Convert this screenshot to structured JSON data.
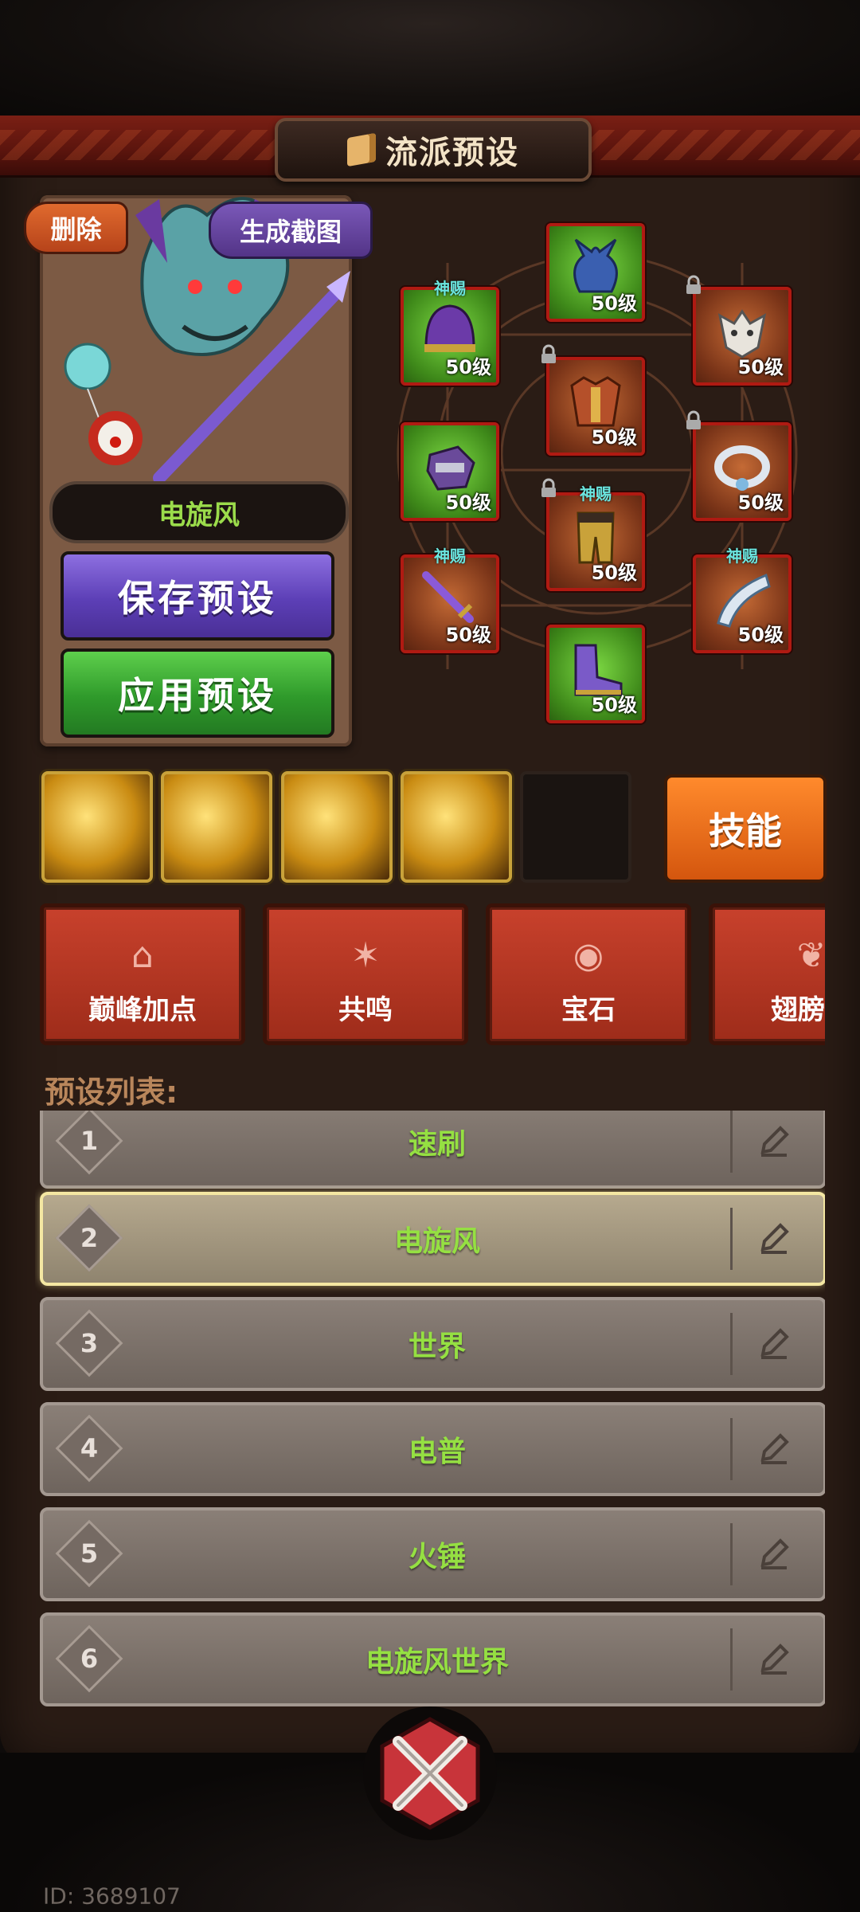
{
  "header": {
    "title": "流派预设"
  },
  "hero": {
    "delete_label": "删除",
    "screenshot_label": "生成截图",
    "build_name": "电旋风",
    "save_label": "保存预设",
    "apply_label": "应用预设"
  },
  "equipment": {
    "slots": [
      {
        "name": "helmet",
        "badge": "神赐",
        "level": "50级",
        "locked": false,
        "rarity": "green"
      },
      {
        "name": "horned-helm",
        "badge": "",
        "level": "50级",
        "locked": false,
        "rarity": "green"
      },
      {
        "name": "beast-mask",
        "badge": "",
        "level": "50级",
        "locked": true,
        "rarity": "orange"
      },
      {
        "name": "chest-armor",
        "badge": "",
        "level": "50级",
        "locked": true,
        "rarity": "orange"
      },
      {
        "name": "gauntlets",
        "badge": "",
        "level": "50级",
        "locked": false,
        "rarity": "green"
      },
      {
        "name": "necklace",
        "badge": "",
        "level": "50级",
        "locked": true,
        "rarity": "orange"
      },
      {
        "name": "legs",
        "badge": "神赐",
        "level": "50级",
        "locked": true,
        "rarity": "orange"
      },
      {
        "name": "weapon",
        "badge": "神赐",
        "level": "50级",
        "locked": false,
        "rarity": "orange"
      },
      {
        "name": "horn",
        "badge": "神赐",
        "level": "50级",
        "locked": false,
        "rarity": "orange"
      },
      {
        "name": "boots",
        "badge": "",
        "level": "50级",
        "locked": false,
        "rarity": "green"
      }
    ]
  },
  "skills": {
    "button_label": "技能",
    "filled_count": 4,
    "total_slots": 5
  },
  "tabs": [
    {
      "label": "巅峰加点",
      "icon": "upgrade-house-icon"
    },
    {
      "label": "共鸣",
      "icon": "resonance-star-icon"
    },
    {
      "label": "宝石",
      "icon": "gem-icon"
    },
    {
      "label": "翅膀信",
      "icon": "wings-icon"
    }
  ],
  "preset_list": {
    "title": "预设列表:",
    "items": [
      {
        "index": "1",
        "name": "速刷",
        "selected": false
      },
      {
        "index": "2",
        "name": "电旋风",
        "selected": true
      },
      {
        "index": "3",
        "name": "世界",
        "selected": false
      },
      {
        "index": "4",
        "name": "电普",
        "selected": false
      },
      {
        "index": "5",
        "name": "火锤",
        "selected": false
      },
      {
        "index": "6",
        "name": "电旋风世界",
        "selected": false
      }
    ]
  },
  "footer": {
    "user_id": "ID: 3689107"
  },
  "colors": {
    "accent_orange": "#d4560e",
    "save_purple": "#5c3fb6",
    "apply_green": "#2f9a2b",
    "tab_red": "#c8412c",
    "name_green": "#95e042"
  }
}
